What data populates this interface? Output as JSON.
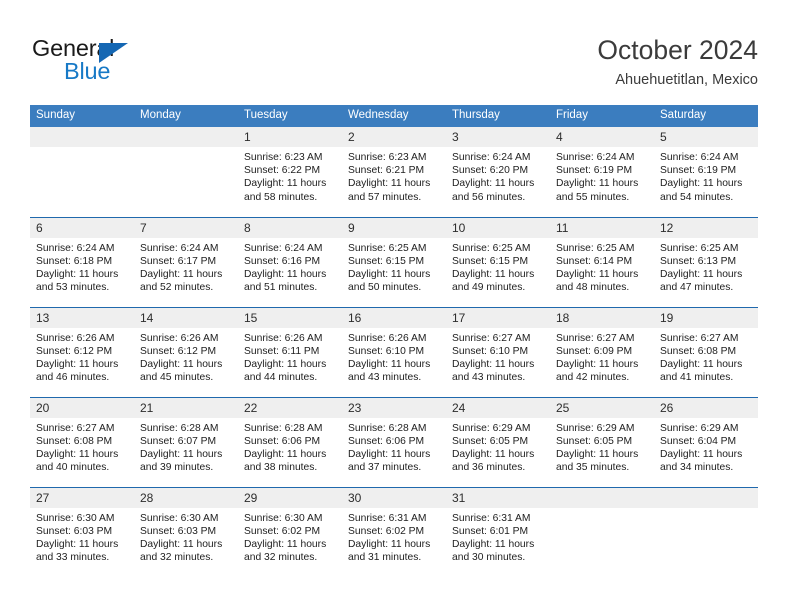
{
  "brand": {
    "name_part1": "General",
    "name_part2": "Blue",
    "triangle_color": "#1567b3",
    "blue_color": "#1779c6"
  },
  "header": {
    "title": "October 2024",
    "subtitle": "Ahuehuetitlan, Mexico"
  },
  "theme": {
    "header_bg": "#3b7dbf",
    "row_separator": "#2069ad",
    "daynum_bg": "#efefef",
    "text": "#1e1e1e"
  },
  "weekday_headers": [
    "Sunday",
    "Monday",
    "Tuesday",
    "Wednesday",
    "Thursday",
    "Friday",
    "Saturday"
  ],
  "weeks": [
    [
      {
        "day": "",
        "sunrise": "",
        "sunset": "",
        "daylight1": "",
        "daylight2": ""
      },
      {
        "day": "",
        "sunrise": "",
        "sunset": "",
        "daylight1": "",
        "daylight2": ""
      },
      {
        "day": "1",
        "sunrise": "Sunrise: 6:23 AM",
        "sunset": "Sunset: 6:22 PM",
        "daylight1": "Daylight: 11 hours",
        "daylight2": "and 58 minutes."
      },
      {
        "day": "2",
        "sunrise": "Sunrise: 6:23 AM",
        "sunset": "Sunset: 6:21 PM",
        "daylight1": "Daylight: 11 hours",
        "daylight2": "and 57 minutes."
      },
      {
        "day": "3",
        "sunrise": "Sunrise: 6:24 AM",
        "sunset": "Sunset: 6:20 PM",
        "daylight1": "Daylight: 11 hours",
        "daylight2": "and 56 minutes."
      },
      {
        "day": "4",
        "sunrise": "Sunrise: 6:24 AM",
        "sunset": "Sunset: 6:19 PM",
        "daylight1": "Daylight: 11 hours",
        "daylight2": "and 55 minutes."
      },
      {
        "day": "5",
        "sunrise": "Sunrise: 6:24 AM",
        "sunset": "Sunset: 6:19 PM",
        "daylight1": "Daylight: 11 hours",
        "daylight2": "and 54 minutes."
      }
    ],
    [
      {
        "day": "6",
        "sunrise": "Sunrise: 6:24 AM",
        "sunset": "Sunset: 6:18 PM",
        "daylight1": "Daylight: 11 hours",
        "daylight2": "and 53 minutes."
      },
      {
        "day": "7",
        "sunrise": "Sunrise: 6:24 AM",
        "sunset": "Sunset: 6:17 PM",
        "daylight1": "Daylight: 11 hours",
        "daylight2": "and 52 minutes."
      },
      {
        "day": "8",
        "sunrise": "Sunrise: 6:24 AM",
        "sunset": "Sunset: 6:16 PM",
        "daylight1": "Daylight: 11 hours",
        "daylight2": "and 51 minutes."
      },
      {
        "day": "9",
        "sunrise": "Sunrise: 6:25 AM",
        "sunset": "Sunset: 6:15 PM",
        "daylight1": "Daylight: 11 hours",
        "daylight2": "and 50 minutes."
      },
      {
        "day": "10",
        "sunrise": "Sunrise: 6:25 AM",
        "sunset": "Sunset: 6:15 PM",
        "daylight1": "Daylight: 11 hours",
        "daylight2": "and 49 minutes."
      },
      {
        "day": "11",
        "sunrise": "Sunrise: 6:25 AM",
        "sunset": "Sunset: 6:14 PM",
        "daylight1": "Daylight: 11 hours",
        "daylight2": "and 48 minutes."
      },
      {
        "day": "12",
        "sunrise": "Sunrise: 6:25 AM",
        "sunset": "Sunset: 6:13 PM",
        "daylight1": "Daylight: 11 hours",
        "daylight2": "and 47 minutes."
      }
    ],
    [
      {
        "day": "13",
        "sunrise": "Sunrise: 6:26 AM",
        "sunset": "Sunset: 6:12 PM",
        "daylight1": "Daylight: 11 hours",
        "daylight2": "and 46 minutes."
      },
      {
        "day": "14",
        "sunrise": "Sunrise: 6:26 AM",
        "sunset": "Sunset: 6:12 PM",
        "daylight1": "Daylight: 11 hours",
        "daylight2": "and 45 minutes."
      },
      {
        "day": "15",
        "sunrise": "Sunrise: 6:26 AM",
        "sunset": "Sunset: 6:11 PM",
        "daylight1": "Daylight: 11 hours",
        "daylight2": "and 44 minutes."
      },
      {
        "day": "16",
        "sunrise": "Sunrise: 6:26 AM",
        "sunset": "Sunset: 6:10 PM",
        "daylight1": "Daylight: 11 hours",
        "daylight2": "and 43 minutes."
      },
      {
        "day": "17",
        "sunrise": "Sunrise: 6:27 AM",
        "sunset": "Sunset: 6:10 PM",
        "daylight1": "Daylight: 11 hours",
        "daylight2": "and 43 minutes."
      },
      {
        "day": "18",
        "sunrise": "Sunrise: 6:27 AM",
        "sunset": "Sunset: 6:09 PM",
        "daylight1": "Daylight: 11 hours",
        "daylight2": "and 42 minutes."
      },
      {
        "day": "19",
        "sunrise": "Sunrise: 6:27 AM",
        "sunset": "Sunset: 6:08 PM",
        "daylight1": "Daylight: 11 hours",
        "daylight2": "and 41 minutes."
      }
    ],
    [
      {
        "day": "20",
        "sunrise": "Sunrise: 6:27 AM",
        "sunset": "Sunset: 6:08 PM",
        "daylight1": "Daylight: 11 hours",
        "daylight2": "and 40 minutes."
      },
      {
        "day": "21",
        "sunrise": "Sunrise: 6:28 AM",
        "sunset": "Sunset: 6:07 PM",
        "daylight1": "Daylight: 11 hours",
        "daylight2": "and 39 minutes."
      },
      {
        "day": "22",
        "sunrise": "Sunrise: 6:28 AM",
        "sunset": "Sunset: 6:06 PM",
        "daylight1": "Daylight: 11 hours",
        "daylight2": "and 38 minutes."
      },
      {
        "day": "23",
        "sunrise": "Sunrise: 6:28 AM",
        "sunset": "Sunset: 6:06 PM",
        "daylight1": "Daylight: 11 hours",
        "daylight2": "and 37 minutes."
      },
      {
        "day": "24",
        "sunrise": "Sunrise: 6:29 AM",
        "sunset": "Sunset: 6:05 PM",
        "daylight1": "Daylight: 11 hours",
        "daylight2": "and 36 minutes."
      },
      {
        "day": "25",
        "sunrise": "Sunrise: 6:29 AM",
        "sunset": "Sunset: 6:05 PM",
        "daylight1": "Daylight: 11 hours",
        "daylight2": "and 35 minutes."
      },
      {
        "day": "26",
        "sunrise": "Sunrise: 6:29 AM",
        "sunset": "Sunset: 6:04 PM",
        "daylight1": "Daylight: 11 hours",
        "daylight2": "and 34 minutes."
      }
    ],
    [
      {
        "day": "27",
        "sunrise": "Sunrise: 6:30 AM",
        "sunset": "Sunset: 6:03 PM",
        "daylight1": "Daylight: 11 hours",
        "daylight2": "and 33 minutes."
      },
      {
        "day": "28",
        "sunrise": "Sunrise: 6:30 AM",
        "sunset": "Sunset: 6:03 PM",
        "daylight1": "Daylight: 11 hours",
        "daylight2": "and 32 minutes."
      },
      {
        "day": "29",
        "sunrise": "Sunrise: 6:30 AM",
        "sunset": "Sunset: 6:02 PM",
        "daylight1": "Daylight: 11 hours",
        "daylight2": "and 32 minutes."
      },
      {
        "day": "30",
        "sunrise": "Sunrise: 6:31 AM",
        "sunset": "Sunset: 6:02 PM",
        "daylight1": "Daylight: 11 hours",
        "daylight2": "and 31 minutes."
      },
      {
        "day": "31",
        "sunrise": "Sunrise: 6:31 AM",
        "sunset": "Sunset: 6:01 PM",
        "daylight1": "Daylight: 11 hours",
        "daylight2": "and 30 minutes."
      },
      {
        "day": "",
        "sunrise": "",
        "sunset": "",
        "daylight1": "",
        "daylight2": ""
      },
      {
        "day": "",
        "sunrise": "",
        "sunset": "",
        "daylight1": "",
        "daylight2": ""
      }
    ]
  ]
}
